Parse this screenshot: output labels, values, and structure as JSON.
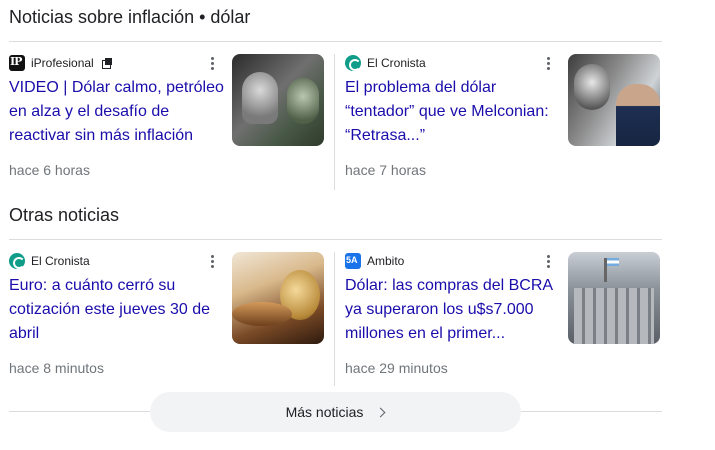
{
  "sections": [
    {
      "title": "Noticias sobre inflación • dólar",
      "cards": [
        {
          "source": "iProfesional",
          "source_logo": "iprofesional-logo-icon",
          "has_publisher_icon": true,
          "headline": "VIDEO | Dólar calmo, petróleo en alza y el desafío de reactivar sin más inflación",
          "time": "hace 6 horas"
        },
        {
          "source": "El Cronista",
          "source_logo": "el-cronista-logo-icon",
          "headline": "El problema del dólar “tentador” que ve Melconian: “Retrasa...”",
          "time": "hace 7 horas"
        }
      ]
    },
    {
      "title": "Otras noticias",
      "cards": [
        {
          "source": "El Cronista",
          "source_logo": "el-cronista-logo-icon",
          "headline": "Euro: a cuánto cerró su cotización este jueves 30 de abril",
          "time": "hace 8 minutos"
        },
        {
          "source": "Ambito",
          "source_logo": "ambito-logo-icon",
          "headline": "Dólar: las compras del BCRA ya superaron los u$s7.000 millones en el primer...",
          "time": "hace 29 minutos"
        }
      ]
    }
  ],
  "more_button": {
    "label": "Más noticias",
    "icon": "chevron-right-icon"
  },
  "colors": {
    "headline_link": "#1a0dab",
    "meta_text": "#70757a",
    "divider": "#dadce0",
    "button_bg": "#f1f3f4"
  }
}
